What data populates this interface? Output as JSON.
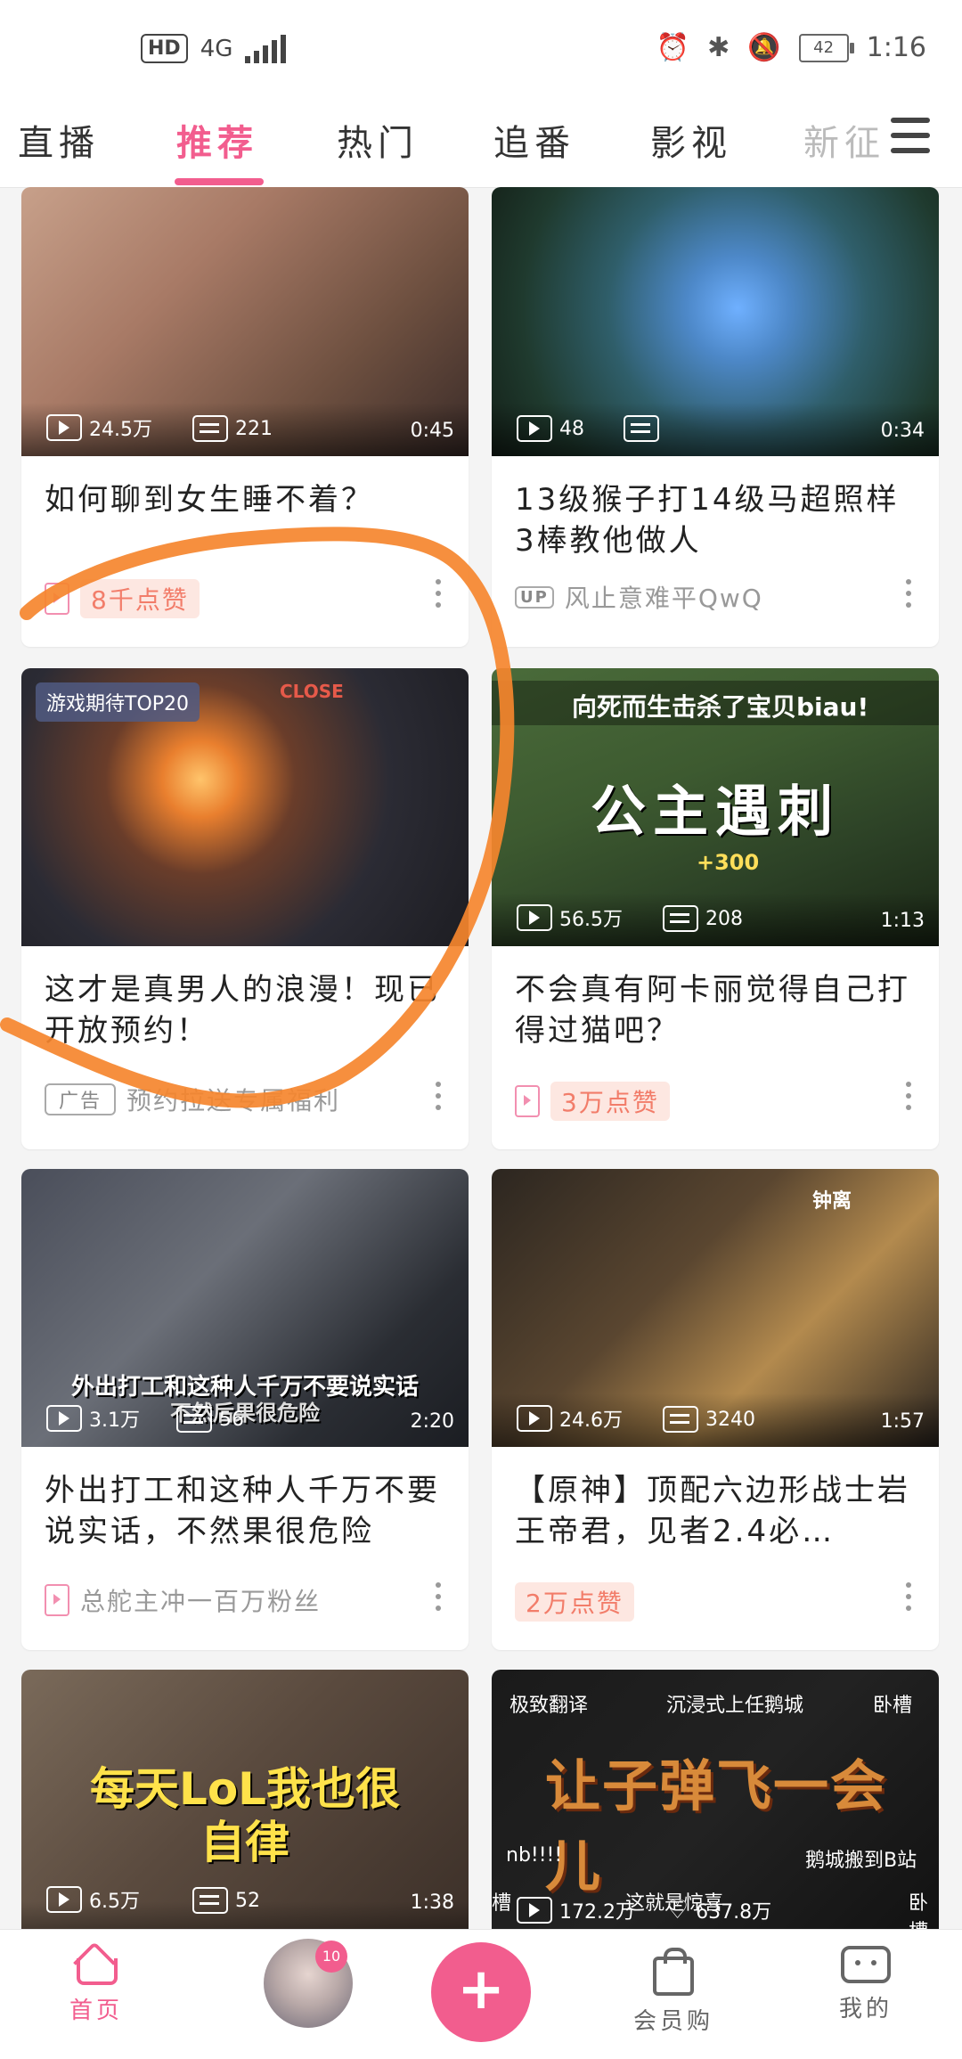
{
  "status_bar": {
    "hd": "HD",
    "network": "4G",
    "battery": "42",
    "time": "1:16"
  },
  "tabs": [
    {
      "label": "直播"
    },
    {
      "label": "推荐"
    },
    {
      "label": "热门"
    },
    {
      "label": "追番"
    },
    {
      "label": "影视"
    },
    {
      "label": "新征"
    }
  ],
  "active_tab": "推荐",
  "feed": [
    {
      "plays": "24.5万",
      "danmaku": "221",
      "duration": "0:45",
      "title": "如何聊到女生睡不着？",
      "like_badge": "8千点赞"
    },
    {
      "plays": "48",
      "danmaku": "",
      "duration": "0:34",
      "title": "13级猴子打14级马超照样3棒教他做人",
      "up_tag": "UP",
      "author": "风止意难平QwQ"
    },
    {
      "corner_tag": "游戏期待TOP20",
      "thumb_text": "CLOSE",
      "title": "这才是真男人的浪漫！现已开放预约！",
      "ad_tag": "广告",
      "ad_text": "预约拉送专属福利"
    },
    {
      "banner": "向死而生击杀了宝贝biau!",
      "caption": "公主遇刺",
      "bonus": "+300",
      "plays": "56.5万",
      "danmaku": "208",
      "duration": "1:13",
      "title": "不会真有阿卡丽觉得自己打得过猫吧？",
      "like_badge": "3万点赞"
    },
    {
      "caption": "外出打工和这种人千万不要说实话",
      "caption2": "不然后果很危险",
      "plays": "3.1万",
      "danmaku": "56",
      "duration": "2:20",
      "title": "外出打工和这种人千万不要说实话，不然果很危险",
      "author": "总舵主冲一百万粉丝"
    },
    {
      "char_name": "钟离",
      "plays": "24.6万",
      "danmaku": "3240",
      "duration": "1:57",
      "title": "【原神】顶配六边形战士岩王帝君，见者2.4必…",
      "like_badge": "2万点赞"
    },
    {
      "caption": "每天LoL我也很自律",
      "plays": "6.5万",
      "danmaku": "52",
      "duration": "1:38"
    },
    {
      "top_left": "极致翻译",
      "top_mid": "沉浸式上任鹅城",
      "top_right": "卧槽",
      "caption": "让子弹飞一会儿",
      "mid_left": "nb!!!!",
      "mid_right": "鹅城搬到B站",
      "bottom_left": "槽",
      "bottom_mid": "这就是惊喜",
      "bottom_right": "卧槽",
      "plays": "172.2万",
      "likes": "637.8万"
    }
  ],
  "bottom_nav": {
    "home": "首页",
    "avatar_badge": "10",
    "plus": "+",
    "shop": "会员购",
    "mine": "我的"
  },
  "colors": {
    "accent": "#f25d8e",
    "like_badge_bg": "#fde7e1",
    "like_badge_text": "#f27d6a",
    "annotation": "#f5862e"
  }
}
